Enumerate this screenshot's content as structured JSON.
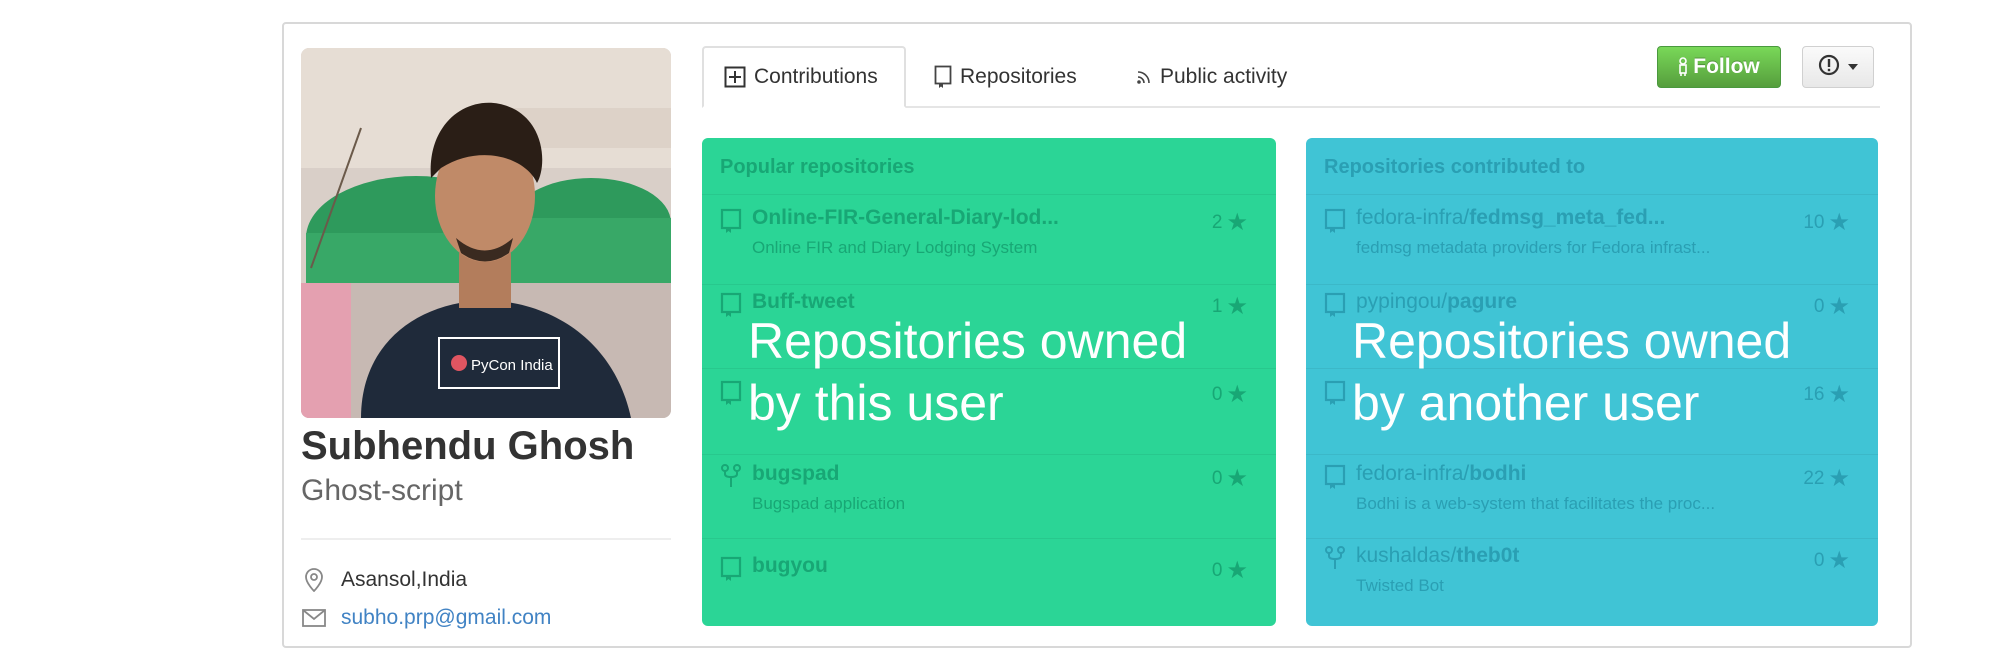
{
  "profile": {
    "full_name": "Subhendu Ghosh",
    "username": "Ghost-script",
    "avatar_badge_text": "PyCon India",
    "location": "Asansol,India",
    "email": "subho.prp@gmail.com"
  },
  "tabs": [
    {
      "label": "Contributions",
      "icon": "plus-square-icon",
      "active": true
    },
    {
      "label": "Repositories",
      "icon": "repo-book-icon",
      "active": false
    },
    {
      "label": "Public activity",
      "icon": "rss-icon",
      "active": false
    }
  ],
  "actions": {
    "follow_label": "Follow",
    "more_icon": "alert-circle-icon"
  },
  "popular_repos": {
    "header": "Popular repositories",
    "overlay_line1": "Repositories owned",
    "overlay_line2": "by this user",
    "items": [
      {
        "name": "Online-FIR-General-Diary-lod...",
        "description": "Online FIR and Diary Lodging System",
        "stars": "2",
        "icon": "repo-icon"
      },
      {
        "name": "Buff-tweet",
        "description": "",
        "stars": "1",
        "icon": "repo-icon"
      },
      {
        "name": "",
        "description": "",
        "stars": "0",
        "icon": "repo-icon"
      },
      {
        "name": "bugspad",
        "description": "Bugspad application",
        "stars": "0",
        "icon": "fork-icon"
      },
      {
        "name": "bugyou",
        "description": "",
        "stars": "0",
        "icon": "repo-icon"
      }
    ]
  },
  "contributed_repos": {
    "header": "Repositories contributed to",
    "overlay_line1": "Repositories owned",
    "overlay_line2": "by another user",
    "items": [
      {
        "owner": "fedora-infra/",
        "name": "fedmsg_meta_fed...",
        "description": "fedmsg metadata providers for Fedora infrast...",
        "stars": "10",
        "icon": "repo-icon"
      },
      {
        "owner": "pypingou/",
        "name": "pagure",
        "description": "",
        "stars": "0",
        "icon": "repo-icon"
      },
      {
        "owner": "",
        "name": "",
        "description": "",
        "stars": "16",
        "icon": "repo-icon"
      },
      {
        "owner": "fedora-infra/",
        "name": "bodhi",
        "description": "Bodhi is a web-system that facilitates the proc...",
        "stars": "22",
        "icon": "repo-icon"
      },
      {
        "owner": "kushaldas/",
        "name": "theb0t",
        "description": "Twisted Bot",
        "stars": "0",
        "icon": "fork-icon"
      }
    ]
  },
  "colors": {
    "panel_own": "#2bd596",
    "panel_contrib": "#40c4d5",
    "follow_green": "#6cc644",
    "link_blue": "#4183c4"
  }
}
